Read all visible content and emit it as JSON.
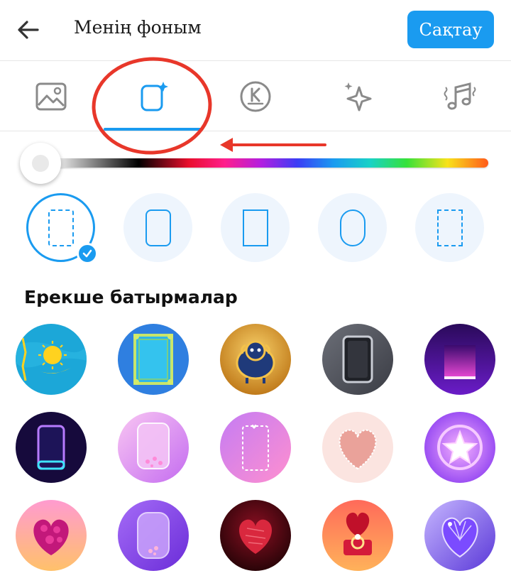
{
  "header": {
    "title": "Менің фоным",
    "save_label": "Сақтау",
    "back_icon": "arrow-left-icon"
  },
  "tabs": [
    {
      "name": "image",
      "icon": "image-icon"
    },
    {
      "name": "frame",
      "icon": "frame-sparkle-icon",
      "selected": true
    },
    {
      "name": "k-logo",
      "icon": "k-logo-icon"
    },
    {
      "name": "effects",
      "icon": "sparkle-icon"
    },
    {
      "name": "music",
      "icon": "music-icon"
    }
  ],
  "colors": {
    "accent": "#1a9bf0",
    "annotation": "#e8372a"
  },
  "color_slider": {
    "position": 0
  },
  "shape_options": [
    "dashed",
    "rounded",
    "square",
    "pill",
    "dashed-square"
  ],
  "section": {
    "title": "Ерекше батырмалар"
  },
  "skins": [
    "kazakhstan-flag",
    "blue-ornament",
    "sheep",
    "dark-frame",
    "purple-glow",
    "neon-frame",
    "pink-glass",
    "pink-dashed",
    "pink-heart",
    "star",
    "heart-petals",
    "purple-glass",
    "red-heart",
    "ring-box",
    "gem-heart"
  ]
}
